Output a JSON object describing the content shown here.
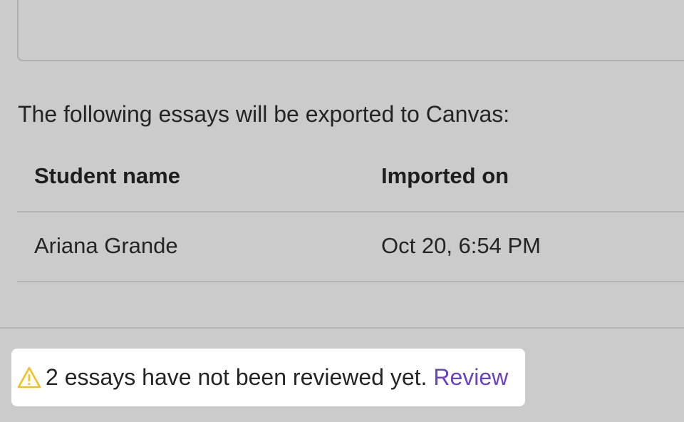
{
  "intro": {
    "text": "The following essays will be exported to Canvas:"
  },
  "table": {
    "headers": {
      "student_name": "Student name",
      "imported_on": "Imported on"
    },
    "rows": [
      {
        "student_name": "Ariana Grande",
        "imported_on": "Oct 20, 6:54 PM"
      }
    ]
  },
  "warning": {
    "icon": "warning-triangle-icon",
    "message": "2 essays have not been reviewed yet.",
    "link_label": "Review",
    "colors": {
      "icon": "#f2c21b",
      "link": "#6a40c4",
      "background": "#ffffff"
    }
  }
}
